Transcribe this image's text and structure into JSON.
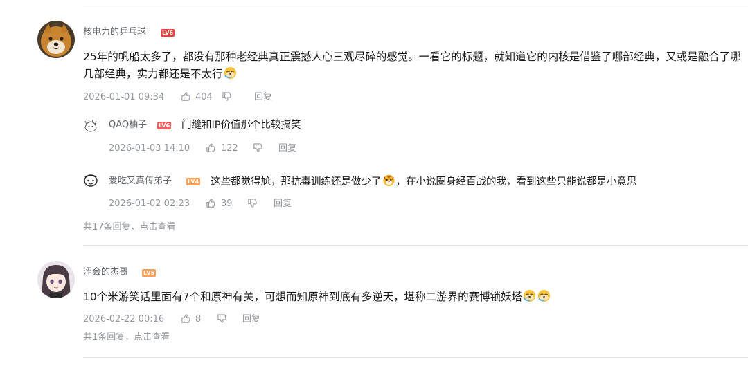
{
  "comments": [
    {
      "user": "核电力的乒乓球",
      "level": "LV6",
      "content_text": "25年的帆船太多了，都没有那种老经典真正震撼人心三观尽碎的感觉。一看它的标题，就知道它的内核是借鉴了哪部经典，又或是融合了哪几部经典，实力都还是不太行",
      "content_emojis": [
        "doge-emoji"
      ],
      "time": "2026-01-01 09:34",
      "likes": "404",
      "reply_label": "回复",
      "replies": [
        {
          "user": "QAQ柚子",
          "level": "LV6",
          "text": "门缝和IP价值那个比较搞笑",
          "time": "2026-01-03 14:10",
          "likes": "122",
          "reply_label": "回复"
        },
        {
          "user": "爱吃又真传弟子",
          "level": "LV4",
          "text_before": "这些都觉得尬，那抗毒训练还是做少了",
          "text_after": "，在小说圈身经百战的我，看到这些只能说都是小意思",
          "emoji": "tiger-emoji",
          "time": "2026-01-02 02:23",
          "likes": "39",
          "reply_label": "回复"
        }
      ],
      "more_replies": "共17条回复，点击查看"
    },
    {
      "user": "涩会的杰哥",
      "level": "LV5",
      "content_text": "10个米游笑话里面有7个和原神有关，可想而知原神到底有多逆天，堪称二游界的赛博锁妖塔",
      "content_emojis": [
        "doge-emoji",
        "doge-emoji"
      ],
      "time": "2026-02-22 00:16",
      "likes": "8",
      "reply_label": "回复",
      "more_replies": "共1条回复，点击查看"
    }
  ],
  "colors": {
    "text_primary": "#18191c",
    "text_secondary": "#61666d",
    "text_meta": "#9499a0",
    "divider": "#e3e5e7",
    "level_red": "#f25d5d",
    "level_orange": "#ff9f55"
  }
}
